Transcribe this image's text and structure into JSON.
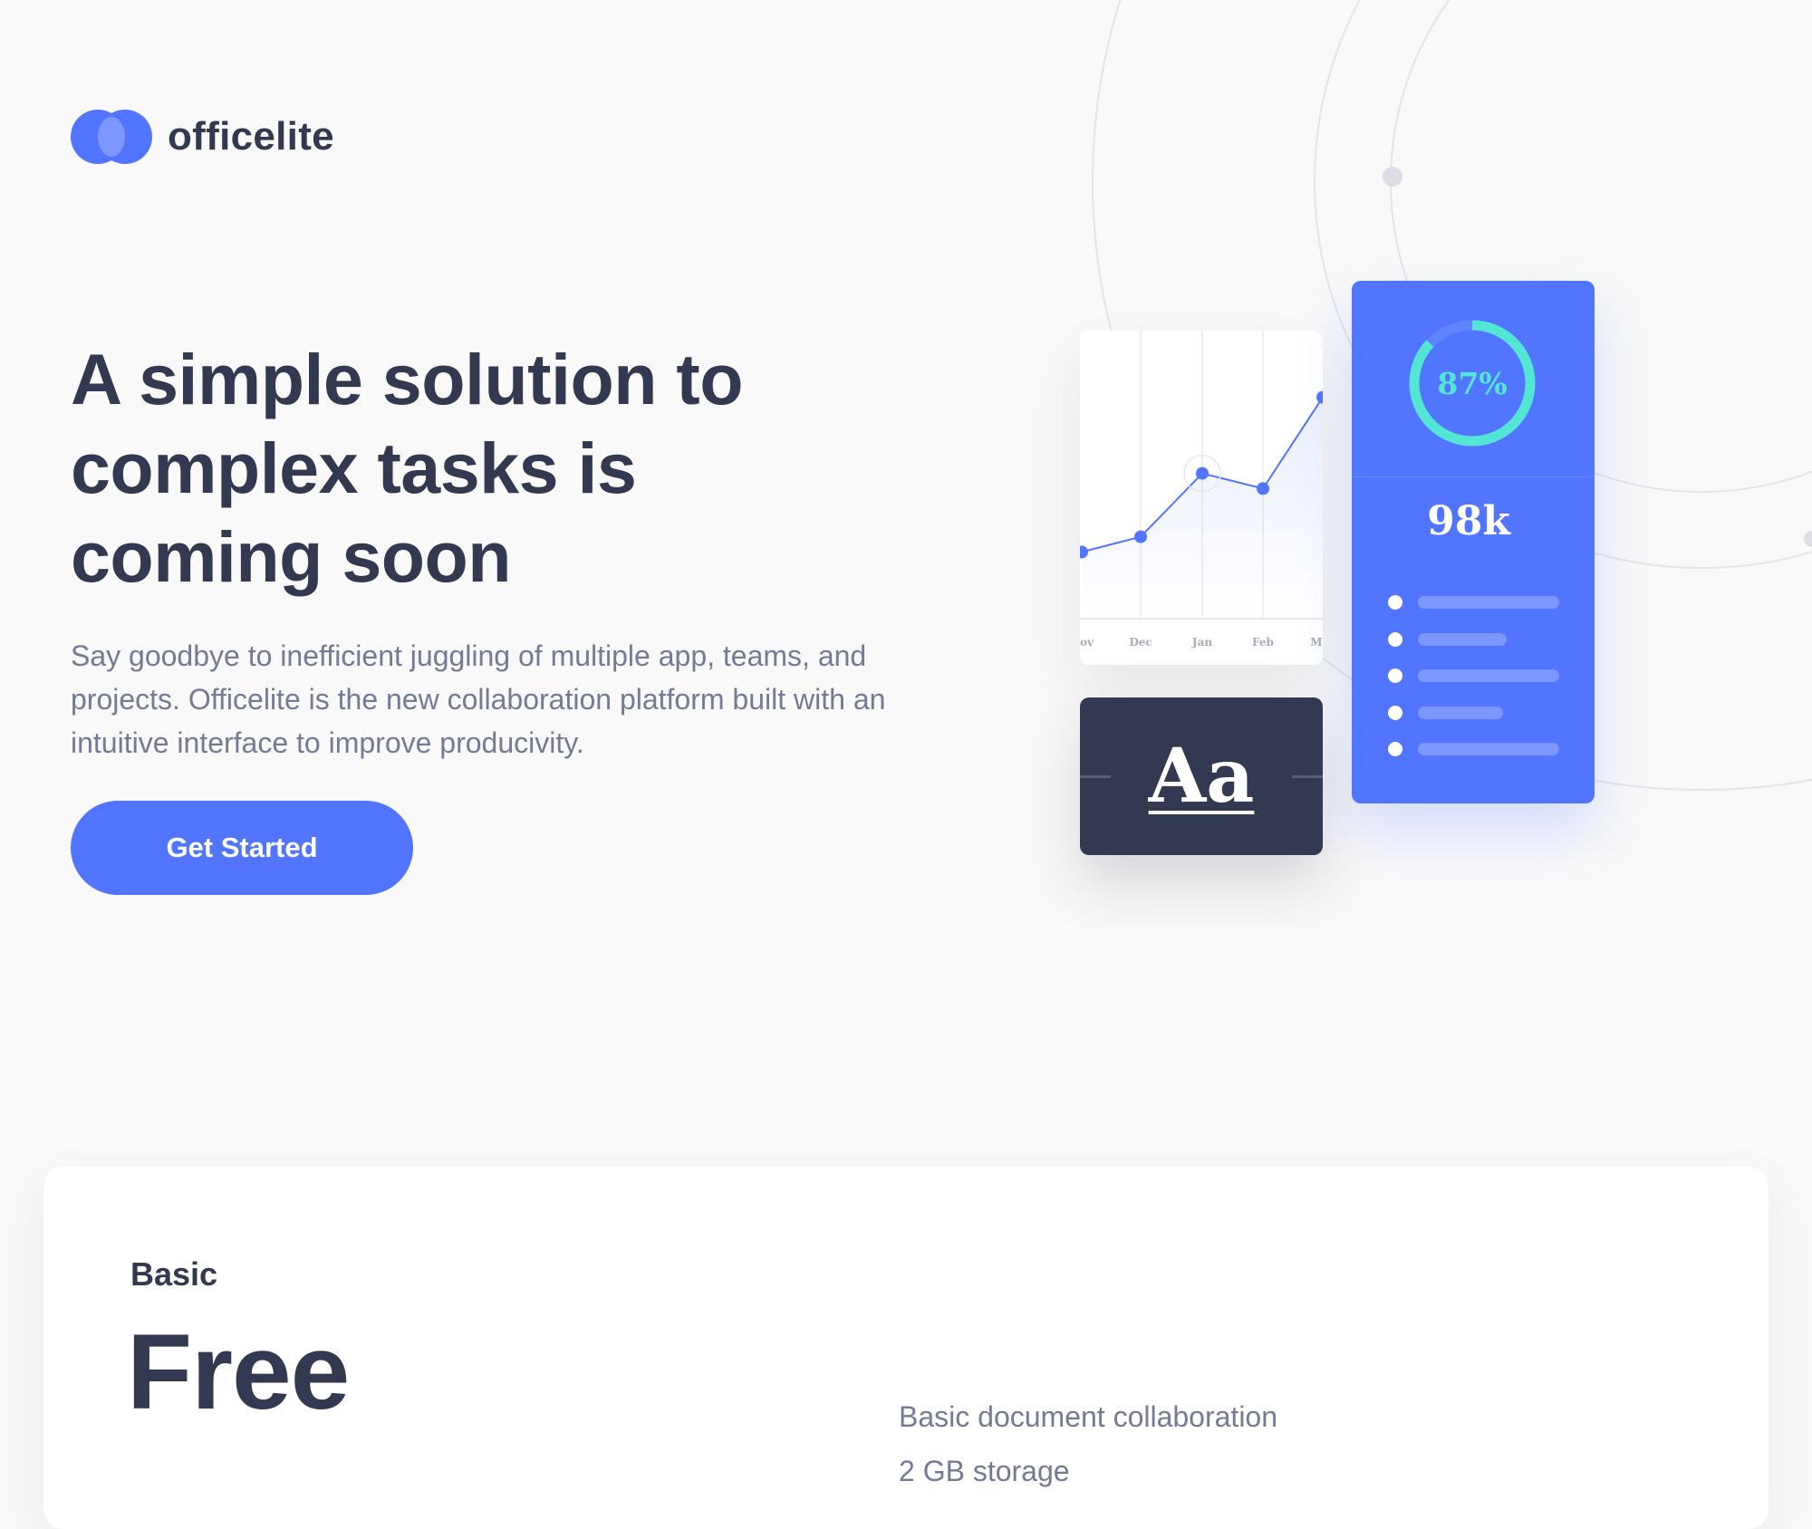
{
  "brand": {
    "name": "officelite",
    "primary": "#5175ff",
    "dark": "#333950",
    "muted": "#747b95",
    "accent": "#54e6d4"
  },
  "hero": {
    "title": "A simple solution to complex tasks is coming soon",
    "description": "Say goodbye to inefficient juggling of multiple app, teams, and projects. Officelite is the new collaboration platform built with an intuitive interface to improve producivity.",
    "cta_label": "Get Started"
  },
  "illustration": {
    "chart_card": {
      "months": [
        "Nov",
        "Dec",
        "Jan",
        "Feb",
        "Mar"
      ],
      "trend": [
        0.27,
        0.33,
        0.58,
        0.52,
        0.88
      ],
      "highlight_month": "Jan"
    },
    "type_card": {
      "sample": "Aa"
    },
    "stats_card": {
      "progress_label": "87%",
      "progress": 0.87,
      "value": "98k",
      "list_item_fill": [
        1.0,
        0.63,
        1.0,
        0.6,
        1.0
      ]
    }
  },
  "pricing": {
    "plan_name": "Basic",
    "price": "Free",
    "features": [
      "Basic document collaboration",
      "2 GB storage"
    ]
  }
}
